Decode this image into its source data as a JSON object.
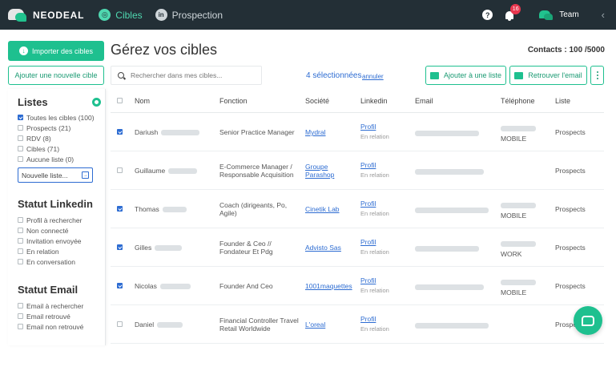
{
  "topbar": {
    "brand": "NEODEAL",
    "nav": [
      {
        "label": "Cibles",
        "active": true
      },
      {
        "label": "Prospection",
        "active": false
      }
    ],
    "notifications": "16",
    "team": "Team"
  },
  "left": {
    "import_label": "Importer des cibles",
    "add_label": "Ajouter une nouvelle cible"
  },
  "sidebar": {
    "listes_title": "Listes",
    "listes": [
      {
        "label": "Toutes les cibles (100)",
        "checked": true
      },
      {
        "label": "Prospects (21)",
        "checked": false
      },
      {
        "label": "RDV (8)",
        "checked": false
      },
      {
        "label": "Cibles (71)",
        "checked": false
      },
      {
        "label": "Aucune liste (0)",
        "checked": false
      }
    ],
    "new_list_placeholder": "Nouvelle liste...",
    "linkedin_title": "Statut Linkedin",
    "linkedin": [
      "Profil à rechercher",
      "Non connecté",
      "Invitation envoyée",
      "En relation",
      "En conversation"
    ],
    "email_title": "Statut Email",
    "email": [
      "Email à rechercher",
      "Email retrouvé",
      "Email non retrouvé"
    ]
  },
  "header": {
    "title": "Gérez vos cibles",
    "contacts": "Contacts : 100 /5000",
    "search_placeholder": "Rechercher dans mes cibles...",
    "selected": "4 sélectionnées",
    "cancel": "annuler",
    "add_to_list": "Ajouter à une liste",
    "find_email": "Retrouver l'email"
  },
  "table": {
    "columns": [
      "Nom",
      "Fonction",
      "Société",
      "Linkedin",
      "Email",
      "Téléphone",
      "Liste"
    ],
    "rows": [
      {
        "checked": true,
        "first": "Dariush",
        "fonction": [
          "Senior Practice Manager"
        ],
        "societe": [
          "Mydral"
        ],
        "linkedin": "Profil",
        "relation": "En relation",
        "phone_type": "MOBILE",
        "liste": "Prospects"
      },
      {
        "checked": false,
        "first": "Guillaume",
        "fonction": [
          "E-Commerce Manager /",
          "Responsable Acquisition"
        ],
        "societe": [
          "Groupe",
          "Parashop"
        ],
        "linkedin": "Profil",
        "relation": "En relation",
        "phone_type": "",
        "liste": "Prospects"
      },
      {
        "checked": true,
        "first": "Thomas",
        "fonction": [
          "Coach (dirigeants, Po,",
          "Agile)"
        ],
        "societe": [
          "Cinetik Lab"
        ],
        "linkedin": "Profil",
        "relation": "En relation",
        "phone_type": "MOBILE",
        "liste": "Prospects"
      },
      {
        "checked": true,
        "first": "Gilles",
        "fonction": [
          "Founder & Ceo //",
          "Fondateur Et Pdg"
        ],
        "societe": [
          "Advisto Sas"
        ],
        "linkedin": "Profil",
        "relation": "En relation",
        "phone_type": "WORK",
        "liste": "Prospects"
      },
      {
        "checked": true,
        "first": "Nicolas",
        "fonction": [
          "Founder And Ceo"
        ],
        "societe": [
          "1001maquettes"
        ],
        "linkedin": "Profil",
        "relation": "En relation",
        "phone_type": "MOBILE",
        "liste": "Prospects"
      },
      {
        "checked": false,
        "first": "Daniel",
        "fonction": [
          "Financial Controller Travel",
          "Retail Worldwide"
        ],
        "societe": [
          "L'oreal"
        ],
        "linkedin": "Profil",
        "relation": "En relation",
        "phone_type": "",
        "liste": "Prospects"
      }
    ]
  },
  "colors": {
    "topbar": "#232f36",
    "accent": "#1ec08f",
    "link": "#2d6cd2",
    "badge": "#e8364e"
  }
}
